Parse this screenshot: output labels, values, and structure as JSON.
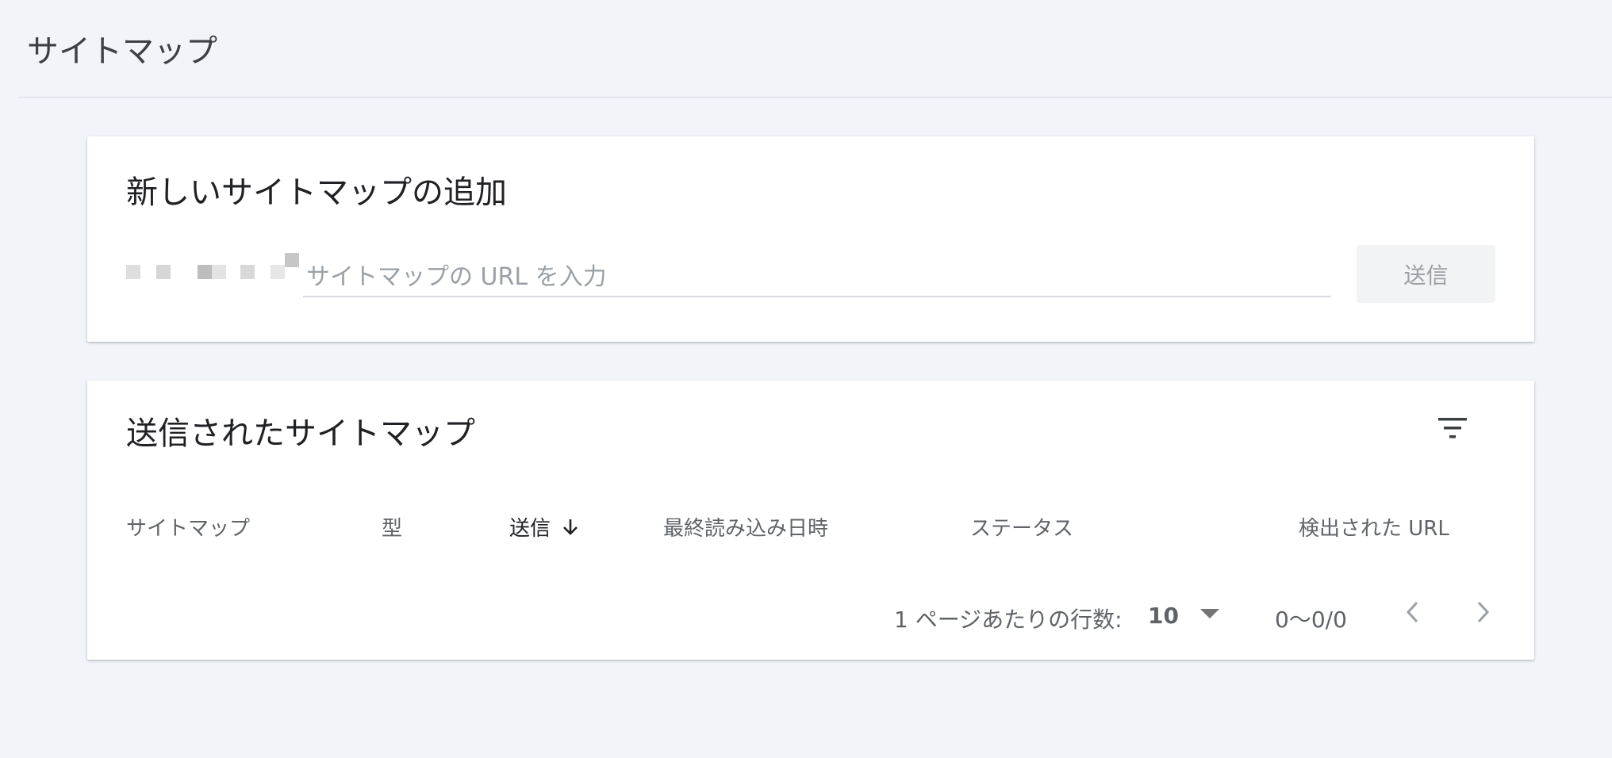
{
  "page": {
    "title": "サイトマップ"
  },
  "add_sitemap": {
    "title": "新しいサイトマップの追加",
    "input_placeholder": "サイトマップの URL を入力",
    "input_value": "",
    "submit_label": "送信"
  },
  "submitted": {
    "title": "送信されたサイトマップ",
    "filter_icon": "filter-list-icon",
    "columns": [
      {
        "label": "サイトマップ"
      },
      {
        "label": "型"
      },
      {
        "label": "送信",
        "sorted": "descending"
      },
      {
        "label": "最終読み込み日時"
      },
      {
        "label": "ステータス"
      },
      {
        "label": "検出された URL"
      }
    ],
    "rows": [],
    "pagination": {
      "rows_per_page_label": "1 ページあたりの行数:",
      "rows_per_page": "10",
      "range": "0〜0/0"
    }
  },
  "colors": {
    "background": "#f1f4f9",
    "card": "#ffffff",
    "primary_text": "#202124",
    "secondary_text": "#5f6368",
    "disabled_button_bg": "#f1f3f4"
  }
}
